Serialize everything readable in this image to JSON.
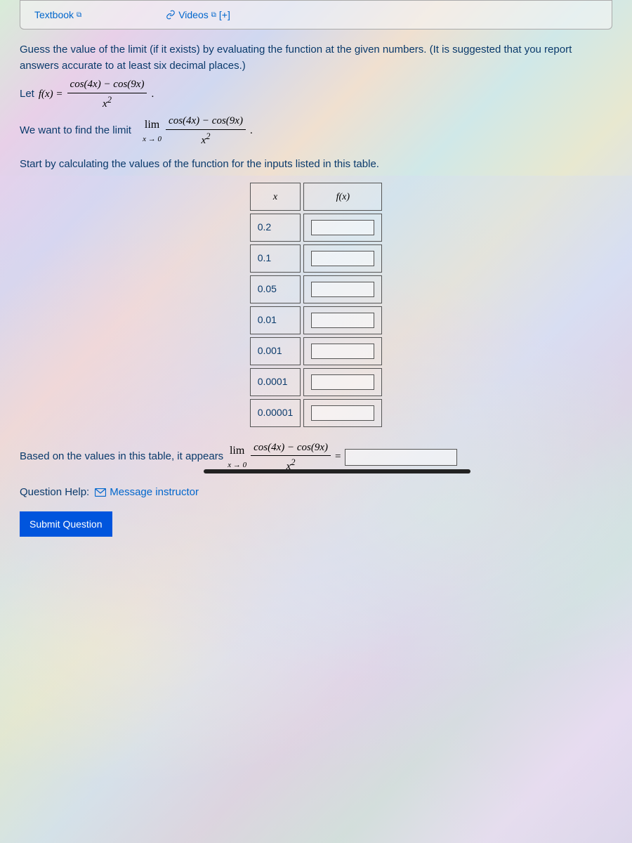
{
  "tabs": {
    "textbook": "Textbook",
    "videos": "Videos",
    "plus": "[+]"
  },
  "problem": {
    "intro": "Guess the value of the limit (if it exists) by evaluating the function at the given numbers. (It is suggested that you report answers accurate to at least six decimal places.)",
    "let": "Let ",
    "fx": "f(x) =",
    "num1": "cos(4x) − cos(9x)",
    "den1": "x",
    "sup2": "2",
    "dot": ".",
    "wewant": "We want to find the limit",
    "lim": "lim",
    "limsub": "x → 0",
    "startby": "Start by calculating the values of the function for the inputs listed in this table.",
    "th_x": "x",
    "th_fx": "f(x)",
    "rows": [
      "0.2",
      "0.1",
      "0.05",
      "0.01",
      "0.001",
      "0.0001",
      "0.00001"
    ],
    "based": "Based on the values in this table, it appears",
    "equals": "="
  },
  "help": {
    "label": "Question Help:",
    "msg": "Message instructor"
  },
  "submit": "Submit Question"
}
